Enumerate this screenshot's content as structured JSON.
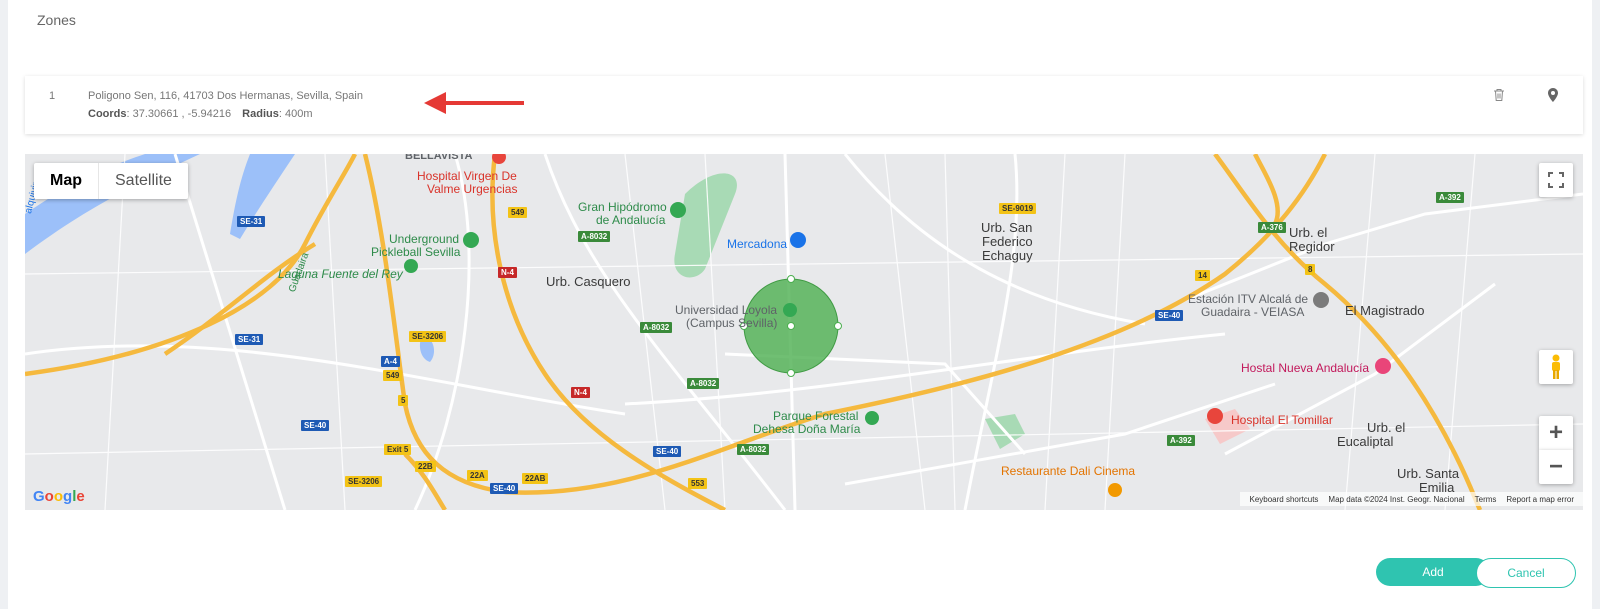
{
  "page": {
    "title": "Zones"
  },
  "zones": [
    {
      "index": "1",
      "address": "Poligono Sen, 116, 41703 Dos Hermanas, Sevilla, Spain",
      "coords_label": "Coords",
      "coords_value": "37.30661 , -5.94216",
      "radius_label": "Radius",
      "radius_value": "400m"
    }
  ],
  "icons": {
    "delete": "trash-icon",
    "locate": "map-pin-icon",
    "annotation": "red-arrow-icon"
  },
  "map": {
    "type_control": {
      "map": "Map",
      "satellite": "Satellite",
      "selected": "Map"
    },
    "logo": "Google",
    "footer": {
      "shortcuts": "Keyboard shortcuts",
      "data": "Map data ©2024 Inst. Geogr. Nacional",
      "terms": "Terms",
      "report": "Report a map error"
    },
    "circle_color": "#4caf50",
    "labels": [
      {
        "id": "bellavista",
        "text": "BELLAVISTA"
      },
      {
        "id": "hospital-valme-1",
        "text": "Hospital Virgen De"
      },
      {
        "id": "hospital-valme-2",
        "text": "Valme Urgencias"
      },
      {
        "id": "underground-1",
        "text": "Underground"
      },
      {
        "id": "underground-2",
        "text": "Pickleball Sevilla"
      },
      {
        "id": "laguna",
        "text": "Laguna Fuente del Rey"
      },
      {
        "id": "guadaira",
        "text": "Guadaira"
      },
      {
        "id": "hipodromo-1",
        "text": "Gran Hipódromo"
      },
      {
        "id": "hipodromo-2",
        "text": "de Andalucía"
      },
      {
        "id": "mercadona",
        "text": "Mercadona"
      },
      {
        "id": "casquero",
        "text": "Urb. Casquero"
      },
      {
        "id": "loyola-1",
        "text": "Universidad Loyola"
      },
      {
        "id": "loyola-2",
        "text": "(Campus Sevilla)"
      },
      {
        "id": "san-federico-1",
        "text": "Urb. San"
      },
      {
        "id": "san-federico-2",
        "text": "Federico"
      },
      {
        "id": "san-federico-3",
        "text": "Echaguy"
      },
      {
        "id": "regidor-1",
        "text": "Urb. el"
      },
      {
        "id": "regidor-2",
        "text": "Regidor"
      },
      {
        "id": "itv-1",
        "text": "Estación ITV Alcalá de"
      },
      {
        "id": "itv-2",
        "text": "Guadaira - VEIASA"
      },
      {
        "id": "magistrado",
        "text": "El Magistrado"
      },
      {
        "id": "hostal",
        "text": "Hostal Nueva Andalucía"
      },
      {
        "id": "tomillar",
        "text": "Hospital El Tomillar"
      },
      {
        "id": "eucaliptal-1",
        "text": "Urb. el"
      },
      {
        "id": "eucaliptal-2",
        "text": "Eucaliptal"
      },
      {
        "id": "parque-1",
        "text": "Parque Forestal"
      },
      {
        "id": "parque-2",
        "text": "Dehesa Doña María"
      },
      {
        "id": "restaurante",
        "text": "Restaurante Dali Cinema"
      },
      {
        "id": "santa-emilia-1",
        "text": "Urb. Santa"
      },
      {
        "id": "santa-emilia-2",
        "text": "Emilia"
      },
      {
        "id": "quivir",
        "text": "alquivir"
      }
    ],
    "roads": [
      {
        "id": "se31-a",
        "text": "SE-31"
      },
      {
        "id": "se31-b",
        "text": "SE-31"
      },
      {
        "id": "se3206-a",
        "text": "SE-3206"
      },
      {
        "id": "se3206-b",
        "text": "SE-3206"
      },
      {
        "id": "a4",
        "text": "A-4"
      },
      {
        "id": "r549-a",
        "text": "549"
      },
      {
        "id": "r549-b",
        "text": "549"
      },
      {
        "id": "n4-a",
        "text": "N-4"
      },
      {
        "id": "n4-b",
        "text": "N-4"
      },
      {
        "id": "a8032-a",
        "text": "A-8032"
      },
      {
        "id": "a8032-b",
        "text": "A-8032"
      },
      {
        "id": "a8032-c",
        "text": "A-8032"
      },
      {
        "id": "a8032-d",
        "text": "A-8032"
      },
      {
        "id": "se40-a",
        "text": "SE-40"
      },
      {
        "id": "se40-b",
        "text": "SE-40"
      },
      {
        "id": "se40-c",
        "text": "SE-40"
      },
      {
        "id": "se40-d",
        "text": "SE-40"
      },
      {
        "id": "se9019",
        "text": "SE-9019"
      },
      {
        "id": "a376",
        "text": "A-376"
      },
      {
        "id": "a392-a",
        "text": "A-392"
      },
      {
        "id": "a392-b",
        "text": "A-392"
      },
      {
        "id": "exit5",
        "text": "Exit 5"
      },
      {
        "id": "r22b",
        "text": "22B"
      },
      {
        "id": "r22a",
        "text": "22A"
      },
      {
        "id": "r22ab",
        "text": "22AB"
      },
      {
        "id": "r553",
        "text": "553"
      },
      {
        "id": "r14",
        "text": "14"
      },
      {
        "id": "r8",
        "text": "8"
      },
      {
        "id": "r5",
        "text": "5"
      }
    ],
    "controls": {
      "zoom_in": "+",
      "zoom_out": "−"
    }
  },
  "actions": {
    "add": "Add",
    "cancel": "Cancel"
  }
}
